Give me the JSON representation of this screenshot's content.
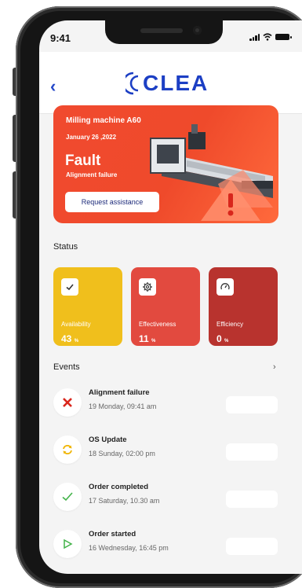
{
  "statusbar": {
    "time": "9:41"
  },
  "header": {
    "back_label": "‹",
    "logo_text": "CLEA"
  },
  "machine_card": {
    "machine_name": "Milling machine A60",
    "date": "January 26 ,2022",
    "state": "Fault",
    "reason": "Alignment failure",
    "assist_button": "Request assistance"
  },
  "status": {
    "title": "Status",
    "tiles": [
      {
        "label": "Availability",
        "value": "43",
        "unit": "%",
        "icon": "checkmark-icon",
        "color": "#f0bf1c"
      },
      {
        "label": "Effectiveness",
        "value": "11",
        "unit": "%",
        "icon": "gear-icon",
        "color": "#e24a3f"
      },
      {
        "label": "Efficiency",
        "value": "0",
        "unit": "%",
        "icon": "gauge-icon",
        "color": "#b8332e"
      }
    ]
  },
  "events": {
    "title": "Events",
    "more_label": "›",
    "items": [
      {
        "title": "Alignment failure",
        "time": "19 Monday, 09:41 am",
        "icon": "x-icon",
        "color": "#d9261c"
      },
      {
        "title": "OS Update",
        "time": "18 Sunday, 02:00 pm",
        "icon": "refresh-icon",
        "color": "#f0b400"
      },
      {
        "title": "Order completed",
        "time": "17 Saturday, 10.30 am",
        "icon": "checkmark-icon",
        "color": "#43b34a"
      },
      {
        "title": "Order started",
        "time": "16 Wednesday, 16:45 pm",
        "icon": "play-icon",
        "color": "#43b34a"
      }
    ]
  }
}
